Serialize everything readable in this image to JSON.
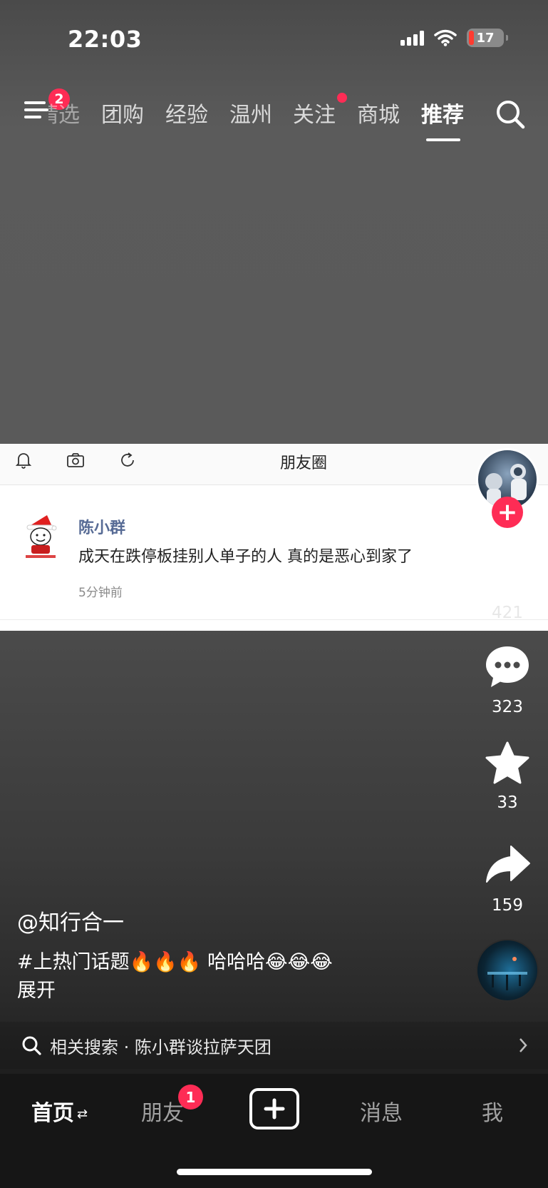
{
  "status_bar": {
    "time": "22:03",
    "battery": "17"
  },
  "top_nav": {
    "menu_badge": "2",
    "tabs": [
      {
        "label": "精选",
        "clipped": true
      },
      {
        "label": "团购"
      },
      {
        "label": "经验"
      },
      {
        "label": "温州"
      },
      {
        "label": "关注"
      },
      {
        "label": "商城"
      },
      {
        "label": "推荐",
        "active": true
      }
    ],
    "search_icon": "search-icon"
  },
  "embedded_screenshot": {
    "header_title": "朋友圈",
    "header_icons": [
      "bell-icon",
      "camera-icon",
      "refresh-icon"
    ],
    "post": {
      "name": "陈小群",
      "text": "成天在跌停板挂别人单子的人  真的是恶心到家了",
      "time": "5分钟前"
    }
  },
  "actions": {
    "like_count": "421",
    "comment_count": "323",
    "favorite_count": "33",
    "share_count": "159"
  },
  "video": {
    "author": "@知行合一",
    "caption": "#上热门话题🔥🔥🔥 哈哈哈😂😂😂",
    "expand": "展开"
  },
  "related_search": {
    "text": "相关搜索 · 陈小群谈拉萨天团"
  },
  "tab_bar": {
    "home": "首页",
    "home_swap": "⇄",
    "friends": "朋友",
    "friends_badge": "1",
    "messages": "消息",
    "me": "我"
  },
  "colors": {
    "accent": "#fe2c55",
    "link_name": "#576b95"
  }
}
